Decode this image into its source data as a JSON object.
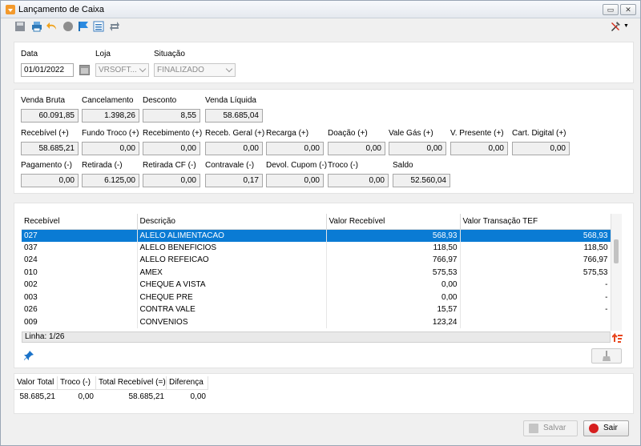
{
  "window": {
    "title": "Lançamento de Caixa"
  },
  "filters": {
    "data_label": "Data",
    "data_value": "01/01/2022",
    "loja_label": "Loja",
    "loja_value": "VRSOFT...",
    "situacao_label": "Situação",
    "situacao_value": "FINALIZADO"
  },
  "totals_row1": [
    {
      "label": "Venda Bruta",
      "value": "60.091,85"
    },
    {
      "label": "Cancelamento",
      "value": "1.398,26"
    },
    {
      "label": "Desconto",
      "value": "8,55"
    },
    {
      "label": "Venda Líquida",
      "value": "58.685,04"
    }
  ],
  "totals_row2": [
    {
      "label": "Recebível (+)",
      "value": "58.685,21"
    },
    {
      "label": "Fundo Troco (+)",
      "value": "0,00"
    },
    {
      "label": "Recebimento (+)",
      "value": "0,00"
    },
    {
      "label": "Receb. Geral (+)",
      "value": "0,00"
    },
    {
      "label": "Recarga (+)",
      "value": "0,00"
    },
    {
      "label": "Doação (+)",
      "value": "0,00"
    },
    {
      "label": "Vale Gás (+)",
      "value": "0,00"
    },
    {
      "label": "V. Presente (+)",
      "value": "0,00"
    },
    {
      "label": "Cart. Digital (+)",
      "value": "0,00"
    }
  ],
  "totals_row3": [
    {
      "label": "Pagamento (-)",
      "value": "0,00"
    },
    {
      "label": "Retirada (-)",
      "value": "6.125,00"
    },
    {
      "label": "Retirada CF (-)",
      "value": "0,00"
    },
    {
      "label": "Contravale (-)",
      "value": "0,17"
    },
    {
      "label": "Devol. Cupom (-)",
      "value": "0,00"
    },
    {
      "label": "Troco (-)",
      "value": "0,00"
    },
    {
      "label": "Saldo",
      "value": "52.560,04"
    }
  ],
  "grid": {
    "columns": [
      "Recebível",
      "Descrição",
      "Valor Recebível",
      "Valor Transação TEF"
    ],
    "rows": [
      [
        "027",
        "ALELO ALIMENTACAO",
        "568,93",
        "568,93"
      ],
      [
        "037",
        "ALELO BENEFICIOS",
        "118,50",
        "118,50"
      ],
      [
        "024",
        "ALELO REFEICAO",
        "766,97",
        "766,97"
      ],
      [
        "010",
        "AMEX",
        "575,53",
        "575,53"
      ],
      [
        "002",
        "CHEQUE A VISTA",
        "0,00",
        "-"
      ],
      [
        "003",
        "CHEQUE PRE",
        "0,00",
        "-"
      ],
      [
        "026",
        "CONTRA VALE",
        "15,57",
        "-"
      ],
      [
        "009",
        "CONVENIOS",
        "123,24",
        ""
      ]
    ],
    "status": "Linha: 1/26"
  },
  "summary": {
    "columns": [
      "Valor Total",
      "Troco (-)",
      "Total Recebível (=)",
      "Diferença"
    ],
    "values": [
      "58.685,21",
      "0,00",
      "58.685,21",
      "0,00"
    ]
  },
  "buttons": {
    "salvar": "Salvar",
    "sair": "Sair"
  }
}
